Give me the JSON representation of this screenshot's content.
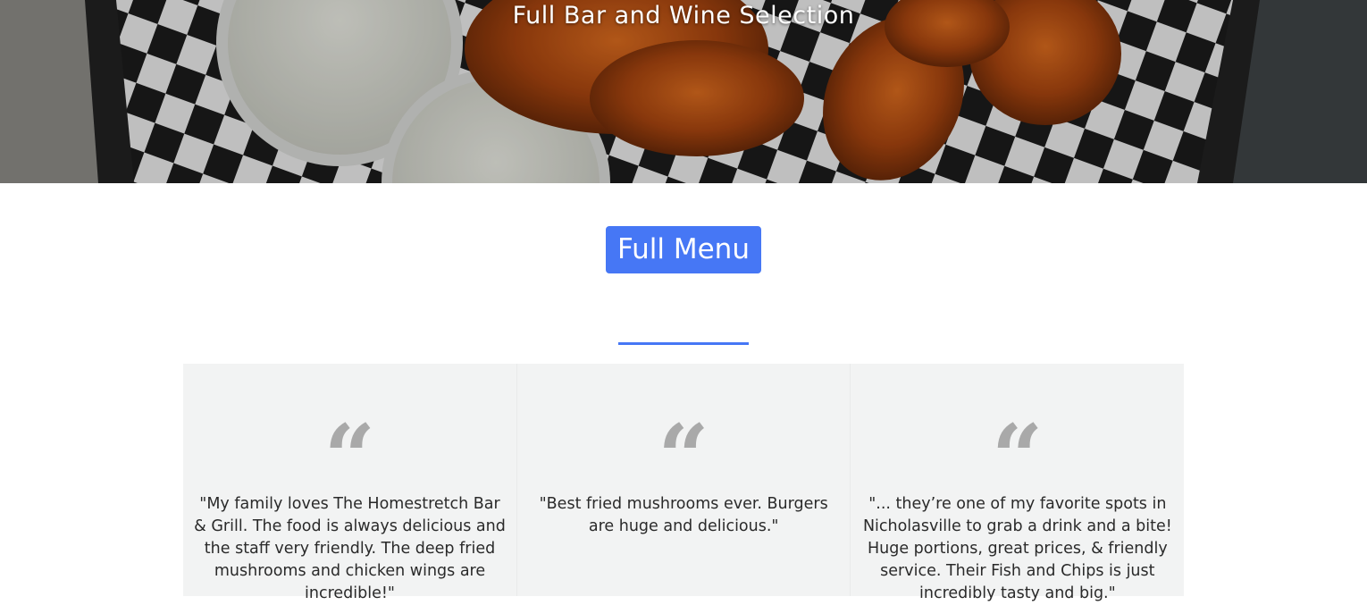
{
  "hero": {
    "tagline": "Full Bar and Wine Selection",
    "image_icon": "wings-food-photo"
  },
  "menu_button": {
    "label": "Full Menu"
  },
  "colors": {
    "accent": "#4677f5",
    "reviews_bg": "#f2f3f3",
    "quote_mark": "#a9a9a9"
  },
  "reviews": [
    {
      "quote_icon": "quote-mark-icon",
      "mark": "“",
      "text": "\"My family loves The Homestretch Bar & Grill. The food is always delicious and the staff very friendly. The deep fried mushrooms and chicken wings are incredible!\""
    },
    {
      "quote_icon": "quote-mark-icon",
      "mark": "“",
      "text": "\"Best fried mushrooms ever. Burgers are huge and delicious.\""
    },
    {
      "quote_icon": "quote-mark-icon",
      "mark": "“",
      "text": "\"... they’re one of my favorite spots in Nicholasville to grab a drink and a bite! Huge portions, great prices, & friendly service. Their Fish and Chips is just incredibly tasty and big.\""
    }
  ]
}
